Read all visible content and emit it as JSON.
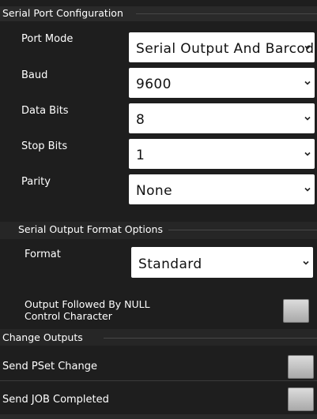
{
  "serial_port": {
    "title": "Serial Port Configuration",
    "rows": [
      {
        "label": "Port Mode",
        "value": "Serial Output And Barcode"
      },
      {
        "label": "Baud",
        "value": "9600"
      },
      {
        "label": "Data Bits",
        "value": "8"
      },
      {
        "label": "Stop Bits",
        "value": "1"
      },
      {
        "label": "Parity",
        "value": "None"
      }
    ]
  },
  "output_format": {
    "title": "Serial Output Format Options",
    "format_label": "Format",
    "format_value": "Standard",
    "null_label_line1": "Output Followed By NULL",
    "null_label_line2": "Control Character"
  },
  "change_outputs": {
    "title": "Change Outputs",
    "pset_label": "Send PSet Change",
    "job_label": "Send JOB Completed"
  },
  "icons": {
    "dropdown": "chevron-down-icon",
    "toggle": "checkbox-toggle"
  },
  "colors": {
    "background": "#1e1e1e",
    "header_bar": "#2a2a2a",
    "select_bg": "#ffffff",
    "toggle": "#c4c4c4"
  }
}
